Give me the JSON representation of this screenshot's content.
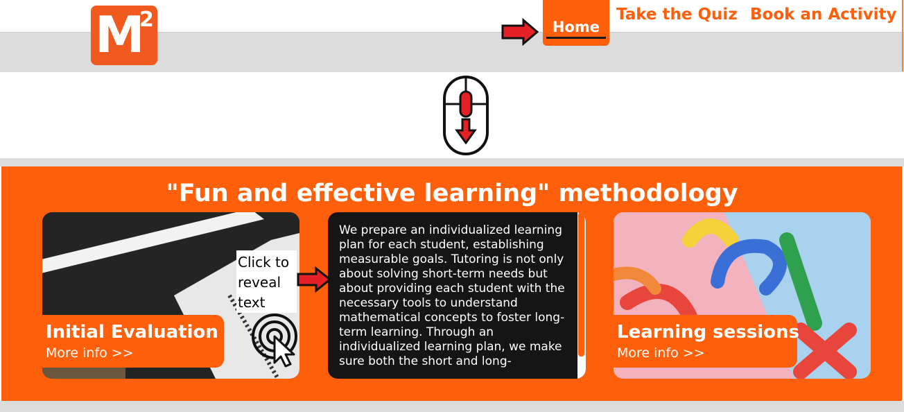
{
  "header": {
    "logo": {
      "letter": "M",
      "superscript": "2"
    },
    "nav": {
      "home_label": "Home",
      "quiz_label": "Take the Quiz",
      "activity_label": "Book an Activity"
    }
  },
  "methodology": {
    "title": "\"Fun and effective learning\" methodology",
    "cards": [
      {
        "title": "Initial Evaluation",
        "more": "More info >>"
      },
      {
        "text": "We prepare an individualized learning plan for each student, establishing measurable goals. Tutoring is not only about solving short-term needs but about providing each student with the necessary tools to understand mathematical concepts to foster long-term learning. Through an individualized learning plan, we make sure both the short and long-"
      },
      {
        "title": "Learning sessions",
        "more": "More info >>"
      }
    ],
    "hint_lines": [
      "Click to",
      "reveal",
      "text"
    ]
  },
  "icons": {
    "nav_arrow": "right-arrow-icon",
    "scroll": "mouse-scroll-icon",
    "click": "click-cursor-icon"
  },
  "colors": {
    "brand_orange": "#fe5f0b",
    "logo_orange": "#f05a1e",
    "header_gray": "#dcdcdc",
    "arrow_red": "#e32127"
  }
}
